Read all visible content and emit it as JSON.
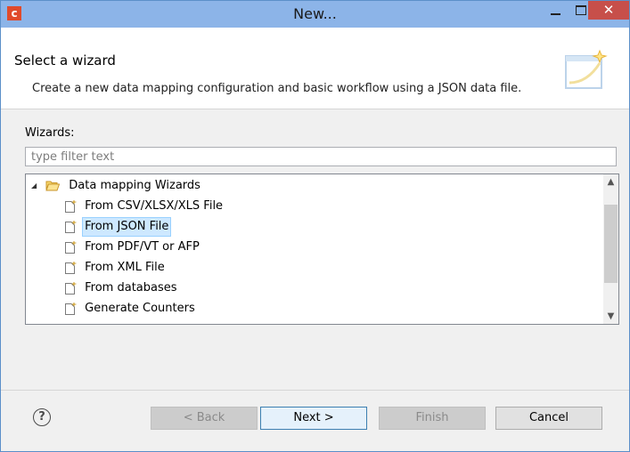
{
  "window": {
    "title": "New...",
    "app_icon_letter": "c",
    "close_glyph": "✕"
  },
  "header": {
    "title": "Select a wizard",
    "description": "Create a new data mapping configuration and basic workflow using a JSON data file."
  },
  "wizards": {
    "label": "Wizards:",
    "filter_placeholder": "type filter text",
    "filter_value": "",
    "root": {
      "label": "Data mapping Wizards",
      "expanded": true,
      "icon": "folder-open-icon"
    },
    "items": [
      {
        "label": "From CSV/XLSX/XLS File",
        "selected": false,
        "icon": "wizard-file-icon"
      },
      {
        "label": "From JSON File",
        "selected": true,
        "icon": "wizard-file-icon"
      },
      {
        "label": "From PDF/VT or AFP",
        "selected": false,
        "icon": "wizard-file-icon"
      },
      {
        "label": "From XML File",
        "selected": false,
        "icon": "wizard-file-icon"
      },
      {
        "label": "From databases",
        "selected": false,
        "icon": "wizard-file-icon"
      },
      {
        "label": "Generate Counters",
        "selected": false,
        "icon": "wizard-file-icon"
      }
    ]
  },
  "buttons": {
    "help": "?",
    "back": "< Back",
    "next": "Next >",
    "finish": "Finish",
    "cancel": "Cancel"
  },
  "colors": {
    "titlebar": "#8cb4e8",
    "close_button": "#c74f4a",
    "selection": "#cde8ff",
    "app_icon": "#e04a2b"
  }
}
